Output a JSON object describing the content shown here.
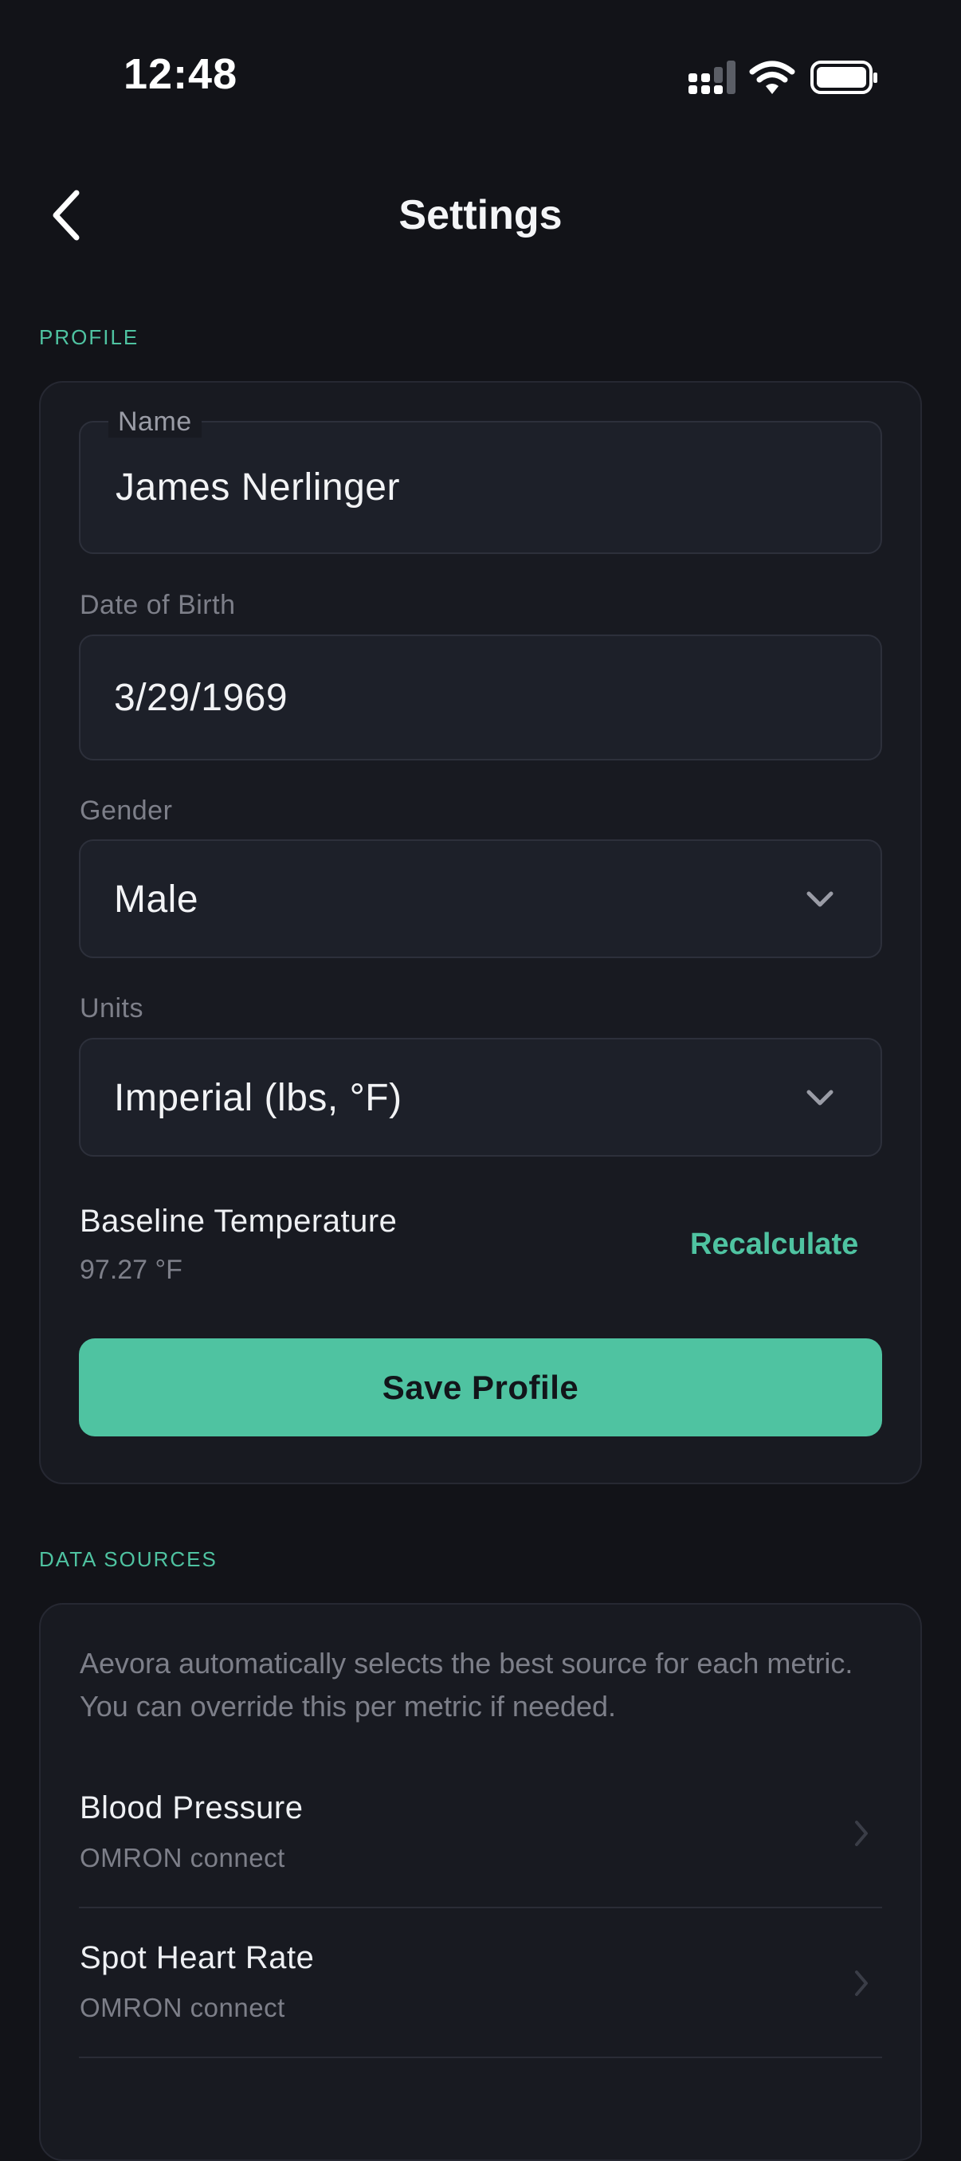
{
  "status_bar": {
    "time": "12:48",
    "icons": [
      "cellular-signal-icon",
      "wifi-icon",
      "battery-icon"
    ]
  },
  "nav": {
    "title": "Settings",
    "back_icon": "chevron-left-icon"
  },
  "profile": {
    "section_label": "PROFILE",
    "name_label": "Name",
    "name_value": "James Nerlinger",
    "dob_label": "Date of Birth",
    "dob_value": "3/29/1969",
    "gender_label": "Gender",
    "gender_value": "Male",
    "units_label": "Units",
    "units_value": "Imperial (lbs, °F)",
    "baseline_title": "Baseline Temperature",
    "baseline_value": "97.27 °F",
    "recalculate_label": "Recalculate",
    "save_label": "Save Profile"
  },
  "data_sources": {
    "section_label": "DATA SOURCES",
    "description": "Aevora automatically selects the best source for each metric. You can override this per metric if needed.",
    "items": [
      {
        "title": "Blood Pressure",
        "source": "OMRON connect"
      },
      {
        "title": "Spot Heart Rate",
        "source": "OMRON connect"
      }
    ]
  },
  "colors": {
    "background": "#121318",
    "card": "#181a21",
    "accent": "#4fc3a1",
    "muted_text": "#7d7f89"
  }
}
